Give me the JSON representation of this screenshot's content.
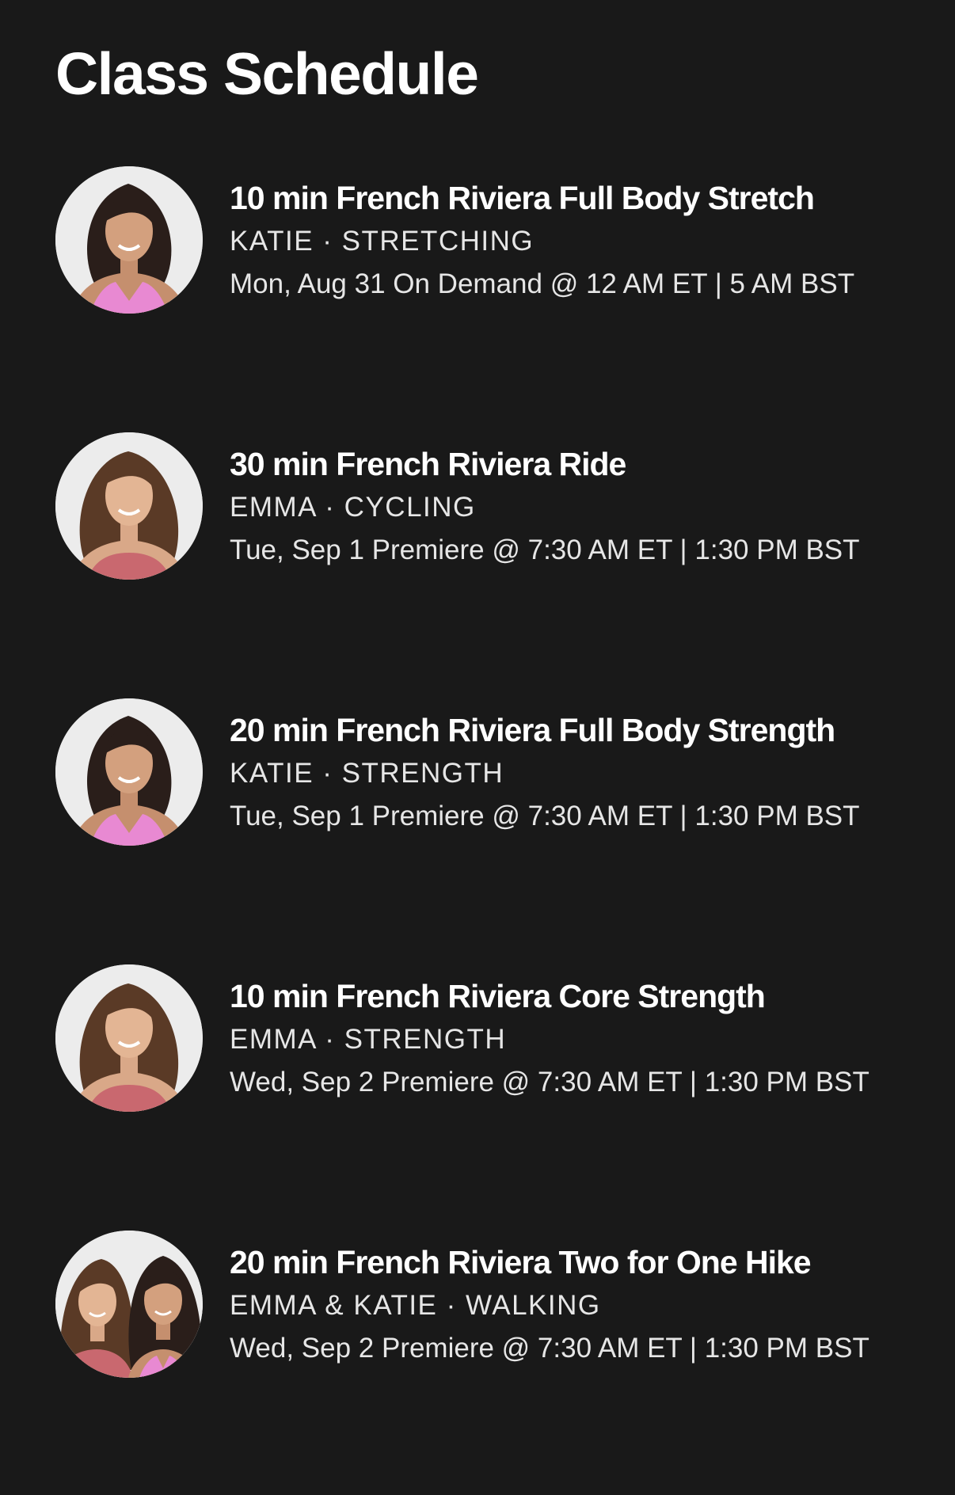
{
  "header": {
    "title": "Class Schedule"
  },
  "classes": [
    {
      "title": "10 min French Riviera Full Body Stretch",
      "meta": "KATIE · STRETCHING",
      "time": "Mon, Aug 31 On Demand @ 12 AM ET | 5 AM BST",
      "avatar_icon": "instructor-katie-avatar"
    },
    {
      "title": "30 min French Riviera Ride",
      "meta": "EMMA · CYCLING",
      "time": "Tue, Sep 1 Premiere @ 7:30 AM ET | 1:30 PM BST",
      "avatar_icon": "instructor-emma-avatar"
    },
    {
      "title": "20 min French Riviera Full Body Strength",
      "meta": "KATIE · STRENGTH",
      "time": "Tue, Sep 1 Premiere @ 7:30 AM ET | 1:30 PM BST",
      "avatar_icon": "instructor-katie-avatar"
    },
    {
      "title": "10 min French Riviera Core Strength",
      "meta": "EMMA · STRENGTH",
      "time": "Wed, Sep 2 Premiere @ 7:30 AM ET | 1:30 PM BST",
      "avatar_icon": "instructor-emma-avatar"
    },
    {
      "title": "20 min French Riviera Two for One Hike",
      "meta": "EMMA & KATIE · WALKING",
      "time": "Wed, Sep 2 Premiere @ 7:30 AM ET | 1:30 PM BST",
      "avatar_icon": "instructors-emma-katie-avatar"
    }
  ],
  "colors": {
    "background": "#191919",
    "text_primary": "#ffffff",
    "text_secondary": "#e6e6e6",
    "avatar_background": "#ececec",
    "katie_top": "#e889d2",
    "emma_top": "#c9686f"
  }
}
